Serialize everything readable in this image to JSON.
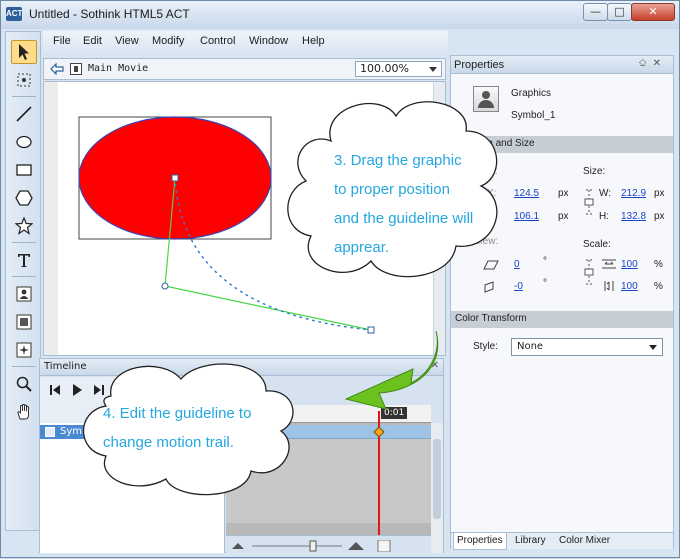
{
  "window": {
    "title": "Untitled - Sothink HTML5 ACT",
    "app_icon_text": "ACT",
    "min": "—",
    "max": "□",
    "close": "✕"
  },
  "menu": [
    "File",
    "Edit",
    "View",
    "Modify",
    "Control",
    "Window",
    "Help"
  ],
  "stage": {
    "movie_label": "Main Movie",
    "zoom": "100.00%"
  },
  "callouts": {
    "drag": [
      "3. Drag the graphic",
      "to proper position",
      "and the guideline will",
      "apprear."
    ],
    "edit": [
      "4. Edit the guideline to",
      "change motion trail."
    ]
  },
  "timeline": {
    "title": "Timeline",
    "close": "✕",
    "time": "00:01.000",
    "layer_name": "Symbol_1",
    "playhead_label": "0:01"
  },
  "properties": {
    "title": "Properties",
    "pin": "⎐",
    "close": "✕",
    "type": "Graphics",
    "name": "Symbol_1",
    "location_section": "Location and Size",
    "location_label": "Location:",
    "size_label": "Size:",
    "x_label": "X:",
    "y_label": "Y:",
    "x": "124.5",
    "y": "106.1",
    "px": "px",
    "w_label": "W:",
    "h_label": "H:",
    "w": "212.9",
    "h": "132.8",
    "skew_label": "Skew:",
    "skew1": "0",
    "skew2": "-0",
    "deg": "°",
    "scale_label": "Scale:",
    "scale1": "100",
    "scale2": "100",
    "pct": "%",
    "color_section": "Color Transform",
    "style_label": "Style:",
    "style_value": "None"
  },
  "panel_tabs": [
    "Properties",
    "Library",
    "Color Mixer"
  ],
  "colors": {
    "shape_fill": "#ff0000",
    "shape_stroke": "#3b44b8",
    "guide_line": "#46d746",
    "motion_dots": "#2f7fd0",
    "callout_text": "#25a7e0",
    "arrow": "#6bc21e"
  }
}
